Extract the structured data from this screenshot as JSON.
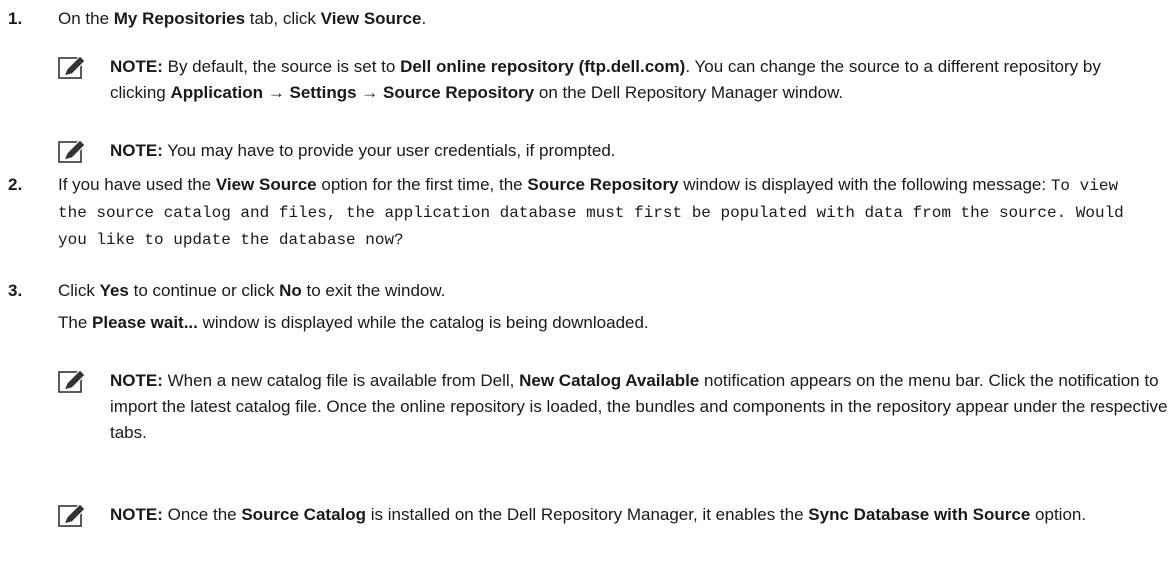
{
  "steps": [
    {
      "number": "1.",
      "text": [
        "On the ",
        "My Repositories",
        " tab, click ",
        "View Source",
        "."
      ],
      "notes": [
        [
          "NOTE:",
          " By default, the source is set to ",
          "Dell online repository (ftp.dell.com)",
          ". You can change the source to a different repository by clicking ",
          "Application",
          " → ",
          "Settings",
          " → ",
          "Source Repository",
          " on the Dell Repository Manager window."
        ],
        [
          "NOTE:",
          " You may have to provide your user credentials, if prompted."
        ]
      ]
    },
    {
      "number": "2.",
      "text": [
        "If you have used the ",
        "View Source",
        " option for the first time, the ",
        "Source Repository",
        " window is displayed with the following message: "
      ],
      "message": "To view the source catalog and files, the application database must first be populated with data from the source. Would you like to update the database now?"
    },
    {
      "number": "3.",
      "text": [
        "Click ",
        "Yes",
        " to continue or click ",
        "No",
        " to exit the window."
      ],
      "subtext": [
        "The ",
        "Please wait...",
        " window is displayed while the catalog is being downloaded."
      ],
      "notes": [
        [
          "NOTE:",
          " When a new catalog file is available from Dell, ",
          "New Catalog Available",
          " notification appears on the menu bar. Click the notification to import the latest catalog file. Once the online repository is loaded, the bundles and components in the repository appear under the respective tabs."
        ],
        [
          "NOTE:",
          " Once the ",
          "Source Catalog",
          " is installed on the Dell Repository Manager, it enables the ",
          "Sync Database with Source",
          " option."
        ]
      ]
    }
  ],
  "note_icon": "pencil-note-icon"
}
